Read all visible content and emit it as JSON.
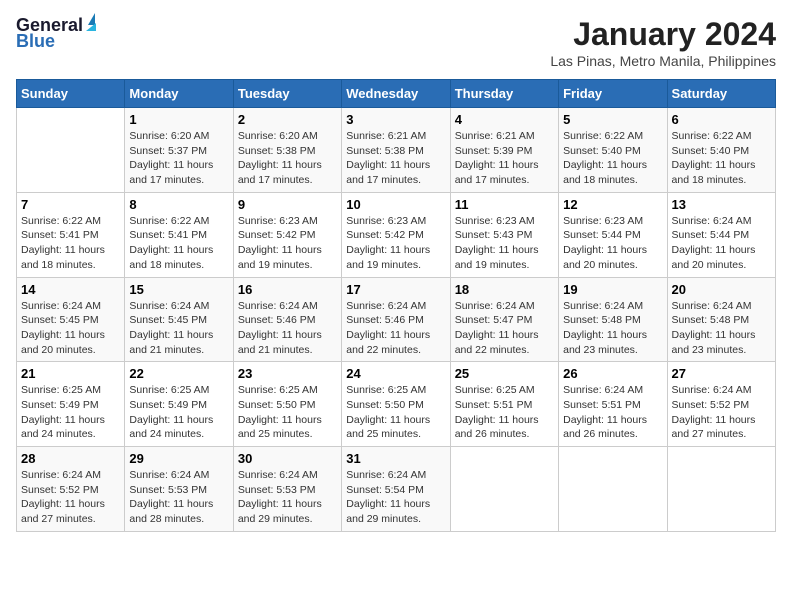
{
  "header": {
    "logo_line1": "General",
    "logo_line2": "Blue",
    "title": "January 2024",
    "subtitle": "Las Pinas, Metro Manila, Philippines"
  },
  "days_of_week": [
    "Sunday",
    "Monday",
    "Tuesday",
    "Wednesday",
    "Thursday",
    "Friday",
    "Saturday"
  ],
  "weeks": [
    [
      {
        "day": "",
        "info": ""
      },
      {
        "day": "1",
        "info": "Sunrise: 6:20 AM\nSunset: 5:37 PM\nDaylight: 11 hours\nand 17 minutes."
      },
      {
        "day": "2",
        "info": "Sunrise: 6:20 AM\nSunset: 5:38 PM\nDaylight: 11 hours\nand 17 minutes."
      },
      {
        "day": "3",
        "info": "Sunrise: 6:21 AM\nSunset: 5:38 PM\nDaylight: 11 hours\nand 17 minutes."
      },
      {
        "day": "4",
        "info": "Sunrise: 6:21 AM\nSunset: 5:39 PM\nDaylight: 11 hours\nand 17 minutes."
      },
      {
        "day": "5",
        "info": "Sunrise: 6:22 AM\nSunset: 5:40 PM\nDaylight: 11 hours\nand 18 minutes."
      },
      {
        "day": "6",
        "info": "Sunrise: 6:22 AM\nSunset: 5:40 PM\nDaylight: 11 hours\nand 18 minutes."
      }
    ],
    [
      {
        "day": "7",
        "info": "Sunrise: 6:22 AM\nSunset: 5:41 PM\nDaylight: 11 hours\nand 18 minutes."
      },
      {
        "day": "8",
        "info": "Sunrise: 6:22 AM\nSunset: 5:41 PM\nDaylight: 11 hours\nand 18 minutes."
      },
      {
        "day": "9",
        "info": "Sunrise: 6:23 AM\nSunset: 5:42 PM\nDaylight: 11 hours\nand 19 minutes."
      },
      {
        "day": "10",
        "info": "Sunrise: 6:23 AM\nSunset: 5:42 PM\nDaylight: 11 hours\nand 19 minutes."
      },
      {
        "day": "11",
        "info": "Sunrise: 6:23 AM\nSunset: 5:43 PM\nDaylight: 11 hours\nand 19 minutes."
      },
      {
        "day": "12",
        "info": "Sunrise: 6:23 AM\nSunset: 5:44 PM\nDaylight: 11 hours\nand 20 minutes."
      },
      {
        "day": "13",
        "info": "Sunrise: 6:24 AM\nSunset: 5:44 PM\nDaylight: 11 hours\nand 20 minutes."
      }
    ],
    [
      {
        "day": "14",
        "info": "Sunrise: 6:24 AM\nSunset: 5:45 PM\nDaylight: 11 hours\nand 20 minutes."
      },
      {
        "day": "15",
        "info": "Sunrise: 6:24 AM\nSunset: 5:45 PM\nDaylight: 11 hours\nand 21 minutes."
      },
      {
        "day": "16",
        "info": "Sunrise: 6:24 AM\nSunset: 5:46 PM\nDaylight: 11 hours\nand 21 minutes."
      },
      {
        "day": "17",
        "info": "Sunrise: 6:24 AM\nSunset: 5:46 PM\nDaylight: 11 hours\nand 22 minutes."
      },
      {
        "day": "18",
        "info": "Sunrise: 6:24 AM\nSunset: 5:47 PM\nDaylight: 11 hours\nand 22 minutes."
      },
      {
        "day": "19",
        "info": "Sunrise: 6:24 AM\nSunset: 5:48 PM\nDaylight: 11 hours\nand 23 minutes."
      },
      {
        "day": "20",
        "info": "Sunrise: 6:24 AM\nSunset: 5:48 PM\nDaylight: 11 hours\nand 23 minutes."
      }
    ],
    [
      {
        "day": "21",
        "info": "Sunrise: 6:25 AM\nSunset: 5:49 PM\nDaylight: 11 hours\nand 24 minutes."
      },
      {
        "day": "22",
        "info": "Sunrise: 6:25 AM\nSunset: 5:49 PM\nDaylight: 11 hours\nand 24 minutes."
      },
      {
        "day": "23",
        "info": "Sunrise: 6:25 AM\nSunset: 5:50 PM\nDaylight: 11 hours\nand 25 minutes."
      },
      {
        "day": "24",
        "info": "Sunrise: 6:25 AM\nSunset: 5:50 PM\nDaylight: 11 hours\nand 25 minutes."
      },
      {
        "day": "25",
        "info": "Sunrise: 6:25 AM\nSunset: 5:51 PM\nDaylight: 11 hours\nand 26 minutes."
      },
      {
        "day": "26",
        "info": "Sunrise: 6:24 AM\nSunset: 5:51 PM\nDaylight: 11 hours\nand 26 minutes."
      },
      {
        "day": "27",
        "info": "Sunrise: 6:24 AM\nSunset: 5:52 PM\nDaylight: 11 hours\nand 27 minutes."
      }
    ],
    [
      {
        "day": "28",
        "info": "Sunrise: 6:24 AM\nSunset: 5:52 PM\nDaylight: 11 hours\nand 27 minutes."
      },
      {
        "day": "29",
        "info": "Sunrise: 6:24 AM\nSunset: 5:53 PM\nDaylight: 11 hours\nand 28 minutes."
      },
      {
        "day": "30",
        "info": "Sunrise: 6:24 AM\nSunset: 5:53 PM\nDaylight: 11 hours\nand 29 minutes."
      },
      {
        "day": "31",
        "info": "Sunrise: 6:24 AM\nSunset: 5:54 PM\nDaylight: 11 hours\nand 29 minutes."
      },
      {
        "day": "",
        "info": ""
      },
      {
        "day": "",
        "info": ""
      },
      {
        "day": "",
        "info": ""
      }
    ]
  ]
}
